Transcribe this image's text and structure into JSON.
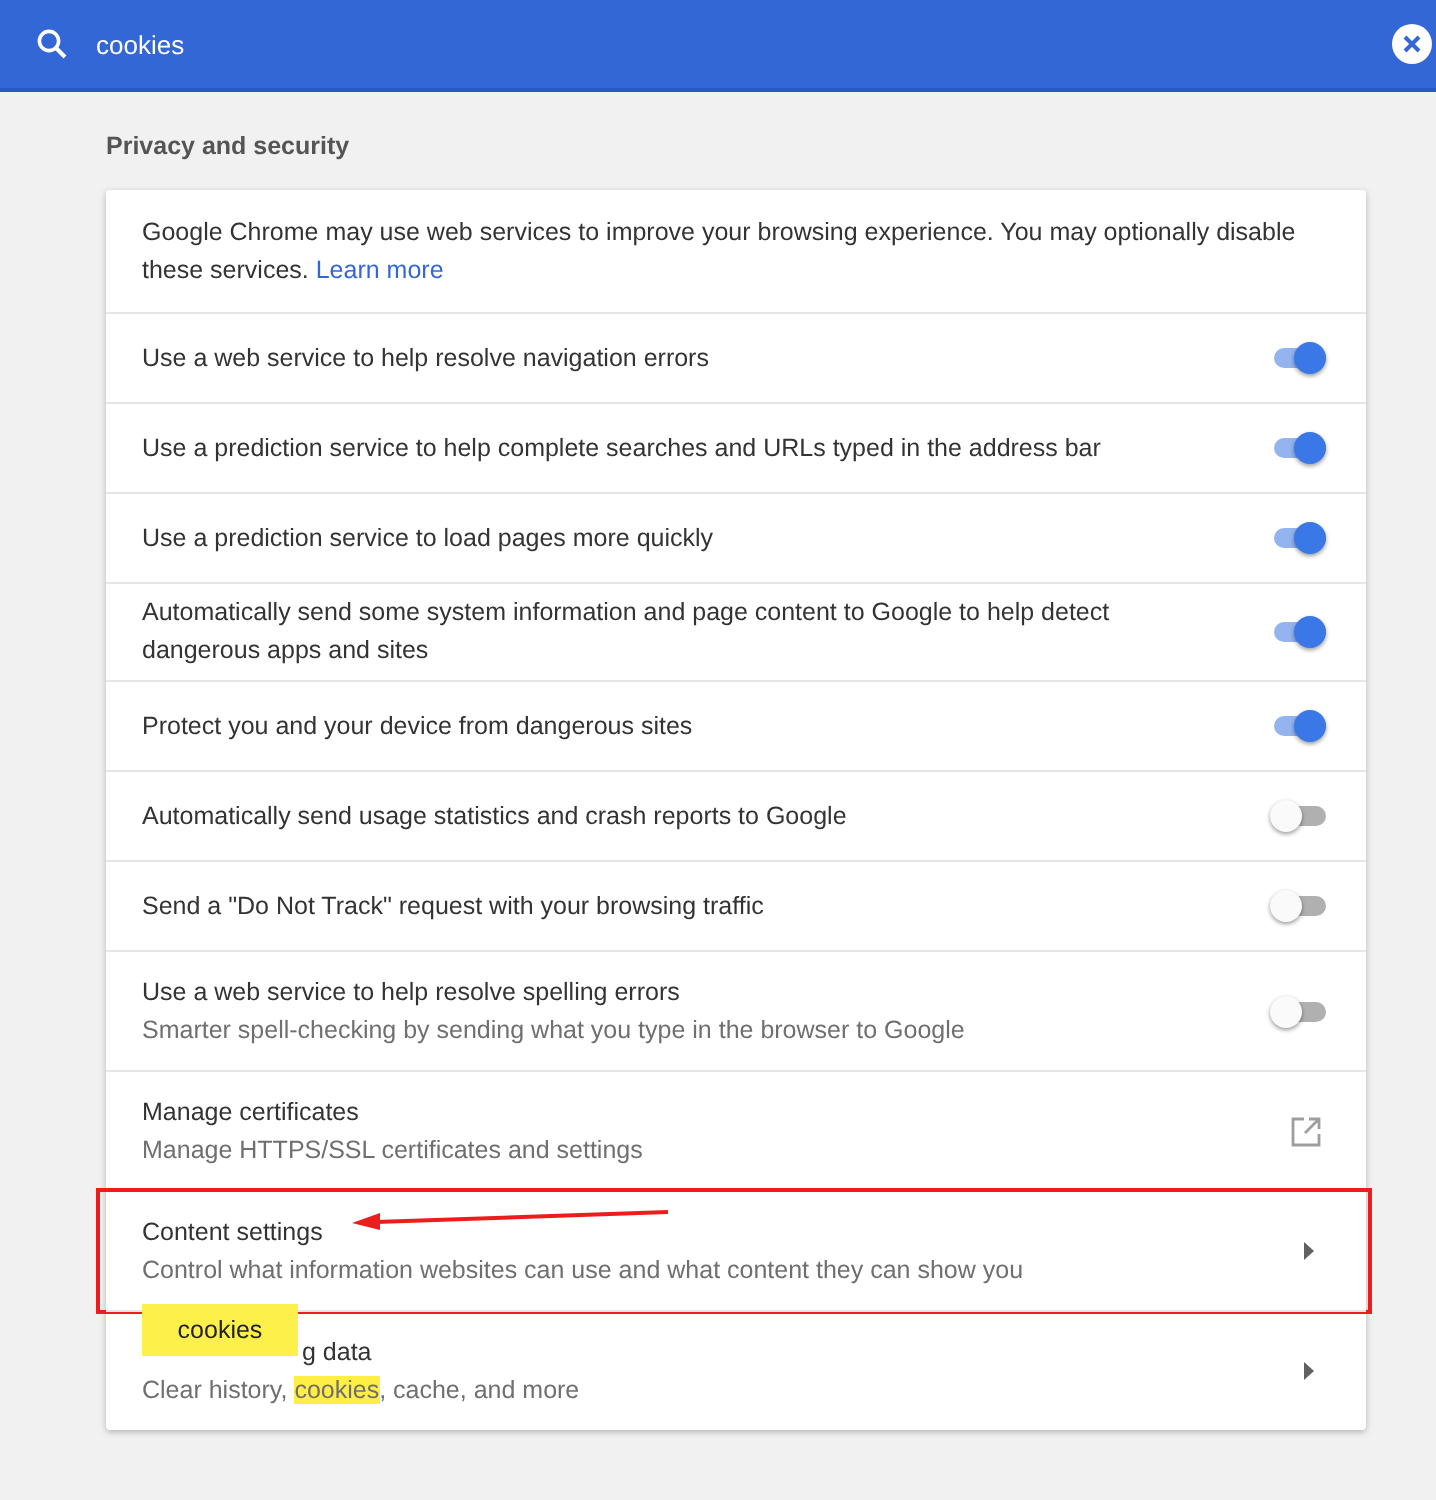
{
  "search": {
    "value": "cookies"
  },
  "section_title": "Privacy and security",
  "intro": {
    "text": "Google Chrome may use web services to improve your browsing experience. You may optionally disable these services.",
    "link": "Learn more"
  },
  "rows": [
    {
      "kind": "toggle",
      "title": "Use a web service to help resolve navigation errors",
      "on": true
    },
    {
      "kind": "toggle",
      "title": "Use a prediction service to help complete searches and URLs typed in the address bar",
      "on": true
    },
    {
      "kind": "toggle",
      "title": "Use a prediction service to load pages more quickly",
      "on": true
    },
    {
      "kind": "toggle",
      "title": "Automatically send some system information and page content to Google to help detect dangerous apps and sites",
      "on": true
    },
    {
      "kind": "toggle",
      "title": "Protect you and your device from dangerous sites",
      "on": true
    },
    {
      "kind": "toggle",
      "title": "Automatically send usage statistics and crash reports to Google",
      "on": false
    },
    {
      "kind": "toggle",
      "title": "Send a \"Do Not Track\" request with your browsing traffic",
      "on": false
    },
    {
      "kind": "toggle",
      "title": "Use a web service to help resolve spelling errors",
      "subtitle": [
        {
          "text": "Smarter spell-checking by sending what you type in the browser to Google",
          "highlight": false
        }
      ],
      "on": false
    },
    {
      "kind": "external",
      "title": "Manage certificates",
      "subtitle": [
        {
          "text": "Manage HTTPS/SSL certificates and settings",
          "highlight": false
        }
      ]
    },
    {
      "kind": "arrow",
      "title": "Content settings",
      "subtitle": [
        {
          "text": "Control what information websites can use and what content they can show you",
          "highlight": false
        }
      ],
      "annotated": true,
      "bubble": "cookies"
    },
    {
      "kind": "arrow",
      "title": "g data",
      "covered": true,
      "subtitle": [
        {
          "text": "Clear history, ",
          "highlight": false
        },
        {
          "text": "cookies",
          "highlight": true
        },
        {
          "text": ", cache, and more",
          "highlight": false
        }
      ]
    }
  ]
}
